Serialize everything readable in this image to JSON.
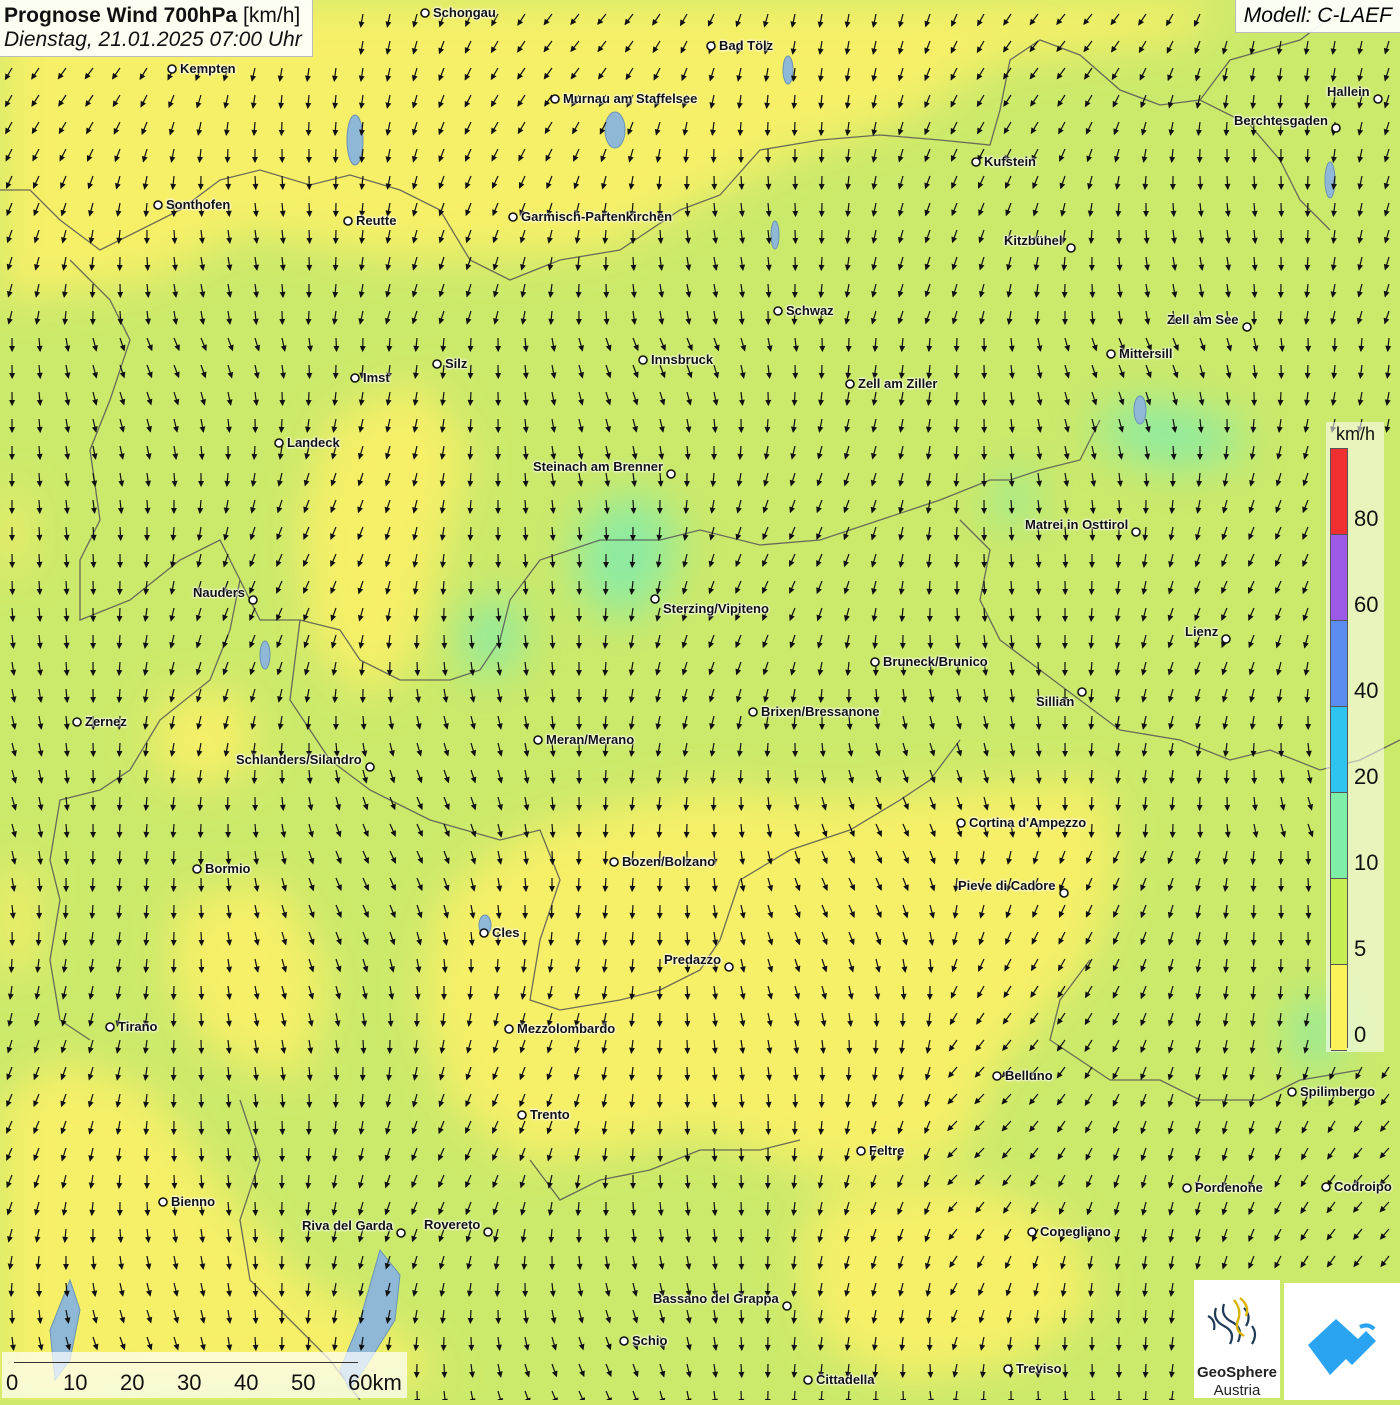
{
  "header": {
    "title_bold": "Prognose Wind 700hPa",
    "title_unit": "[km/h]",
    "datetime": "Dienstag, 21.01.2025 07:00 Uhr",
    "model": "Modell: C-LAEF"
  },
  "legend": {
    "unit": "km/h",
    "labels": [
      "80",
      "60",
      "40",
      "20",
      "10",
      "5",
      "0"
    ],
    "colors": [
      "#f03030",
      "#9b59e6",
      "#5b8cf0",
      "#2ec4f0",
      "#7fefa8",
      "#c6ee50",
      "#fbf25a"
    ]
  },
  "scale_bar": {
    "labels": [
      "0",
      "10",
      "20",
      "30",
      "40",
      "50",
      "60km"
    ]
  },
  "cities": [
    {
      "name": "Schongau"
    },
    {
      "name": "Kempten"
    },
    {
      "name": "Bad Tölz"
    },
    {
      "name": "Murnau am Staffelsee"
    },
    {
      "name": "Hallein"
    },
    {
      "name": "Berchtesgaden"
    },
    {
      "name": "Kufstein"
    },
    {
      "name": "Sonthofen"
    },
    {
      "name": "Reutte"
    },
    {
      "name": "Garmisch-Partenkirchen"
    },
    {
      "name": "Kitzbühel"
    },
    {
      "name": "Schwaz"
    },
    {
      "name": "Zell am See"
    },
    {
      "name": "Mittersill"
    },
    {
      "name": "Innsbruck"
    },
    {
      "name": "Silz"
    },
    {
      "name": "Imst"
    },
    {
      "name": "Zell am Ziller"
    },
    {
      "name": "Landeck"
    },
    {
      "name": "Steinach am Brenner"
    },
    {
      "name": "Matrei in Osttirol"
    },
    {
      "name": "Nauders"
    },
    {
      "name": "Sterzing/Vipiteno"
    },
    {
      "name": "Lienz"
    },
    {
      "name": "Bruneck/Brunico"
    },
    {
      "name": "Sillian"
    },
    {
      "name": "Brixen/Bressanone"
    },
    {
      "name": "Zernez"
    },
    {
      "name": "Meran/Merano"
    },
    {
      "name": "Schlanders/Silandro"
    },
    {
      "name": "Cortina d'Ampezzo"
    },
    {
      "name": "Bozen/Bolzano"
    },
    {
      "name": "Bormio"
    },
    {
      "name": "Pieve di Cadore"
    },
    {
      "name": "Cles"
    },
    {
      "name": "Predazzo"
    },
    {
      "name": "Tirano"
    },
    {
      "name": "Mezzolombardo"
    },
    {
      "name": "Belluno"
    },
    {
      "name": "Spilimbergo"
    },
    {
      "name": "Trento"
    },
    {
      "name": "Feltre"
    },
    {
      "name": "Bienno"
    },
    {
      "name": "Pordenone"
    },
    {
      "name": "Codroipo"
    },
    {
      "name": "Riva del Garda"
    },
    {
      "name": "Rovereto"
    },
    {
      "name": "Conegliano"
    },
    {
      "name": "Bassano del Grappa"
    },
    {
      "name": "Schio"
    },
    {
      "name": "Treviso"
    },
    {
      "name": "Cittadella"
    }
  ],
  "logos": {
    "geosphere_line1": "GeoSphere",
    "geosphere_line2": "Austria"
  }
}
